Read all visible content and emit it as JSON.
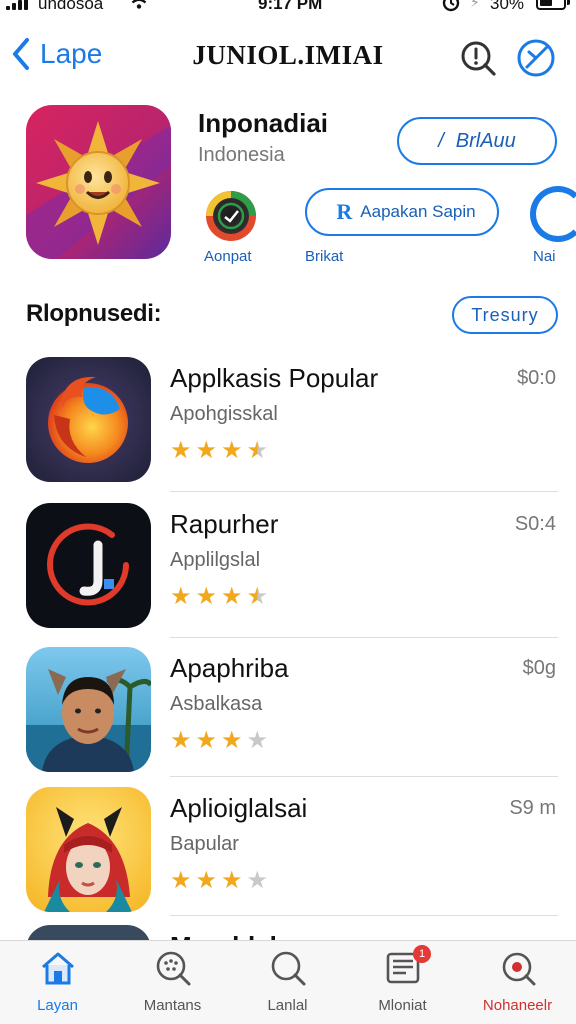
{
  "status_bar": {
    "carrier": "undosoa",
    "time": "9:17 PM",
    "battery": "30%"
  },
  "nav": {
    "back_label": "Lape",
    "title": "JUNIOL.IMIAI"
  },
  "featured": {
    "name": "Inponadiai",
    "subtitle": "Indonesia",
    "save_label": "BrlAuu",
    "chips": [
      {
        "label": "Aonpat"
      },
      {
        "label": "Brikat",
        "pill": "Aapakan Sapin",
        "pill_mark": "R"
      },
      {
        "label": "Nai"
      }
    ]
  },
  "section": {
    "title": "Rlopnusedi:",
    "see_all": "Tresury"
  },
  "apps": [
    {
      "title": "Applkasis Popular",
      "subtitle": "Apohgisskal",
      "price": "$0:0",
      "rating": 3.5
    },
    {
      "title": "Rapurher",
      "subtitle": "Applilgslal",
      "price": "S0:4",
      "rating": 3.5
    },
    {
      "title": "Apaphriba",
      "subtitle": "Asbalkasa",
      "price": "$0g",
      "rating": 3
    },
    {
      "title": "Aplioiglalsai",
      "subtitle": "Bapular",
      "price": "S9 m",
      "rating": 3
    },
    {
      "title": "Marghlal"
    }
  ],
  "tabbar": [
    {
      "label": "Layan",
      "icon": "home-icon"
    },
    {
      "label": "Mantans",
      "icon": "discover-icon"
    },
    {
      "label": "Lanlal",
      "icon": "search-icon"
    },
    {
      "label": "Mloniat",
      "icon": "news-icon",
      "badge": "1"
    },
    {
      "label": "Nohaneelr",
      "icon": "target-icon"
    }
  ],
  "colors": {
    "accent": "#1a7be6",
    "star": "#f2a81d",
    "star_empty": "#c9c9c9",
    "badge": "#e53935"
  }
}
